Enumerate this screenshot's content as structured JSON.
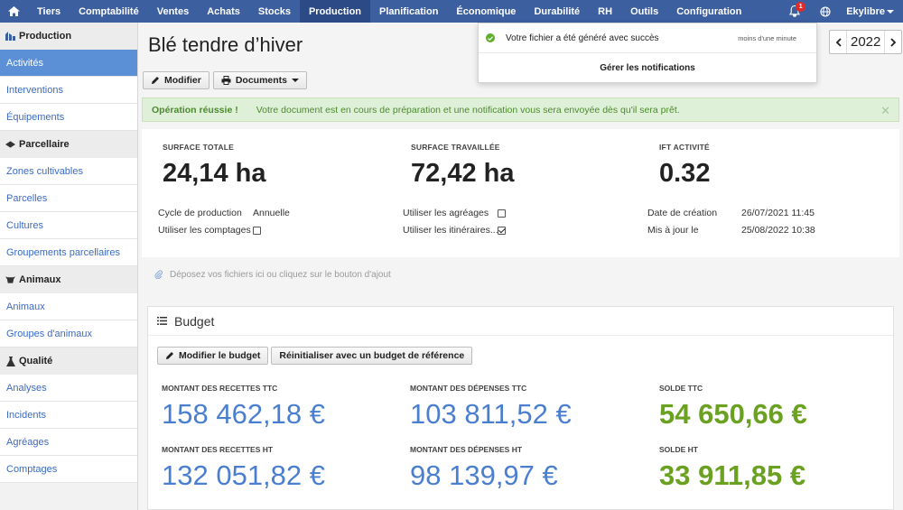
{
  "nav": {
    "items": [
      "Tiers",
      "Comptabilité",
      "Ventes",
      "Achats",
      "Stocks",
      "Production",
      "Planification",
      "Économique",
      "Durabilité",
      "RH",
      "Outils",
      "Configuration"
    ],
    "active": "Production",
    "notification_count": "1",
    "user": "Ekylibre"
  },
  "sidebar": {
    "sections": [
      {
        "title": "Production",
        "icon": "production-icon",
        "items": [
          "Activités",
          "Interventions",
          "Équipements"
        ]
      },
      {
        "title": "Parcellaire",
        "icon": "land-icon",
        "items": [
          "Zones cultivables",
          "Parcelles",
          "Cultures",
          "Groupements parcellaires"
        ]
      },
      {
        "title": "Animaux",
        "icon": "cow-icon",
        "items": [
          "Animaux",
          "Groupes d'animaux"
        ]
      },
      {
        "title": "Qualité",
        "icon": "flask-icon",
        "items": [
          "Analyses",
          "Incidents",
          "Agréages",
          "Comptages"
        ]
      }
    ],
    "active_item": "Activités"
  },
  "page": {
    "title": "Blé tendre d’hiver",
    "year": "2022",
    "buttons": {
      "edit": "Modifier",
      "documents": "Documents"
    }
  },
  "alert": {
    "title": "Opération réussie !",
    "message": "Votre document est en cours de préparation et une notification vous sera envoyée dès qu'il sera prêt."
  },
  "summary": {
    "stats": [
      {
        "label": "SURFACE TOTALE",
        "value": "24,14 ha"
      },
      {
        "label": "SURFACE TRAVAILLÉE",
        "value": "72,42 ha"
      },
      {
        "label": "IFT ACTIVITÉ",
        "value": "0.32"
      }
    ],
    "cycle_label": "Cycle de production",
    "cycle_value": "Annuelle",
    "counts_label": "Utiliser les comptages",
    "counts_checked": false,
    "agreages_label": "Utiliser les agréages",
    "agreages_checked": false,
    "itineraires_label": "Utiliser les itinéraires...",
    "itineraires_checked": true,
    "created_label": "Date de création",
    "created_value": "26/07/2021 11:45",
    "updated_label": "Mis à jour le",
    "updated_value": "25/08/2022 10:38"
  },
  "dropzone": {
    "text": "Déposez vos fichiers ici ou cliquez sur le bouton d'ajout"
  },
  "budget": {
    "title": "Budget",
    "buttons": {
      "edit": "Modifier le budget",
      "reset": "Réinitialiser avec un budget de référence"
    },
    "cells": [
      {
        "label": "MONTANT DES RECETTES TTC",
        "value": "158 462,18 €"
      },
      {
        "label": "MONTANT DES DÉPENSES TTC",
        "value": "103 811,52 €"
      },
      {
        "label": "SOLDE TTC",
        "value": "54 650,66 €"
      },
      {
        "label": "MONTANT DES RECETTES HT",
        "value": "132 051,82 €"
      },
      {
        "label": "MONTANT DES DÉPENSES HT",
        "value": "98 139,97 €"
      },
      {
        "label": "SOLDE HT",
        "value": "33 911,85 €"
      }
    ]
  },
  "notification": {
    "message": "Votre fichier a été généré avec succès",
    "time": "moins d'une minute",
    "manage": "Gérer les notifications"
  },
  "colors": {
    "nav": "#3c5fa0",
    "link": "#3a6bc4",
    "accent_blue": "#4a7fd0",
    "accent_green": "#6aa121",
    "success_bg": "#dff0d8"
  }
}
